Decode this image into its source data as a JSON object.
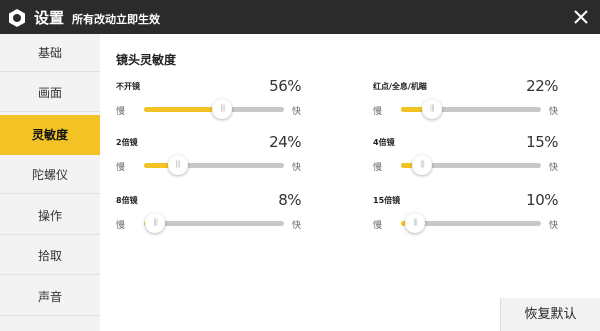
{
  "header": {
    "title": "设置",
    "subtitle": "所有改动立即生效"
  },
  "sidebar": {
    "items": [
      {
        "label": "基础"
      },
      {
        "label": "画面"
      },
      {
        "label": "灵敏度",
        "active": true
      },
      {
        "label": "陀螺仪"
      },
      {
        "label": "操作"
      },
      {
        "label": "拾取"
      },
      {
        "label": "声音"
      }
    ]
  },
  "main": {
    "section_title": "镜头灵敏度",
    "slow_label": "慢",
    "fast_label": "快",
    "sliders": [
      {
        "label": "不开镜",
        "value": "56%",
        "fraction": 0.56
      },
      {
        "label": "红点/全息/机瞄",
        "value": "22%",
        "fraction": 0.22
      },
      {
        "label": "2倍镜",
        "value": "24%",
        "fraction": 0.24
      },
      {
        "label": "4倍镜",
        "value": "15%",
        "fraction": 0.15
      },
      {
        "label": "8倍镜",
        "value": "8%",
        "fraction": 0.08
      },
      {
        "label": "15倍镜",
        "value": "10%",
        "fraction": 0.1
      }
    ],
    "reset_label": "恢复默认"
  },
  "colors": {
    "accent": "#f3c325",
    "topbar": "#2b2b2b",
    "sidebar_bg": "#f3f3f3",
    "track": "#c8c8c8"
  }
}
